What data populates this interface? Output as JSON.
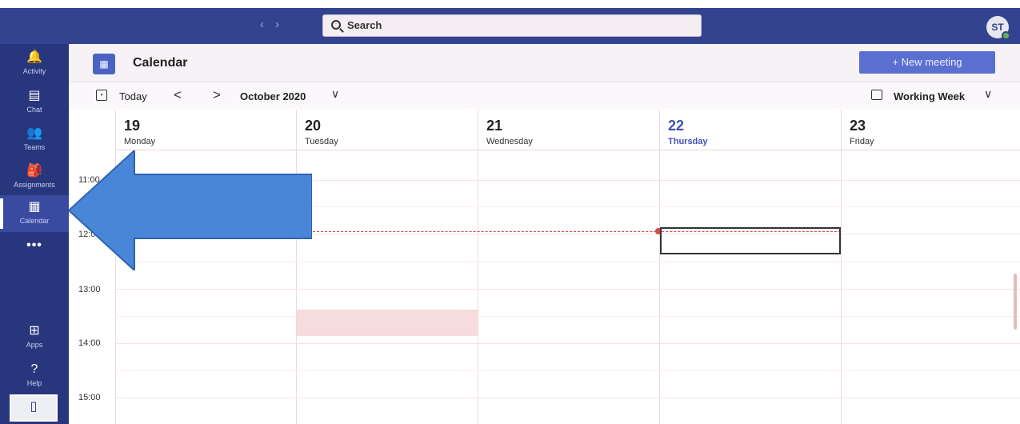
{
  "topbar": {
    "back_glyph": "‹",
    "forward_glyph": "›",
    "search_placeholder": "Search",
    "avatar_initials": "ST"
  },
  "rail": {
    "items": [
      {
        "label": "Activity",
        "icon": "bell-icon",
        "glyph": "🔔"
      },
      {
        "label": "Chat",
        "icon": "chat-icon",
        "glyph": "▤"
      },
      {
        "label": "Teams",
        "icon": "teams-icon",
        "glyph": "👥"
      },
      {
        "label": "Assignments",
        "icon": "assignments-icon",
        "glyph": "🎒"
      },
      {
        "label": "Calendar",
        "icon": "calendar-icon",
        "glyph": "▦"
      },
      {
        "label": "Apps",
        "icon": "apps-icon",
        "glyph": "⊞"
      },
      {
        "label": "Help",
        "icon": "help-icon",
        "glyph": "?"
      }
    ],
    "more_glyph": "•••",
    "device_glyph": "▯"
  },
  "calendar": {
    "title": "Calendar",
    "new_meeting_label": "+ New meeting",
    "today_label": "Today",
    "prev_glyph": "<",
    "next_glyph": ">",
    "month_label": "October 2020",
    "view_label": "Working Week",
    "chevron_glyph": "∨",
    "days": [
      {
        "num": "19",
        "name": "Monday"
      },
      {
        "num": "20",
        "name": "Tuesday"
      },
      {
        "num": "21",
        "name": "Wednesday"
      },
      {
        "num": "22",
        "name": "Thursday",
        "today": true
      },
      {
        "num": "23",
        "name": "Friday"
      }
    ],
    "times": [
      "11:00",
      "12:00",
      "13:00",
      "14:00",
      "15:00"
    ]
  },
  "colors": {
    "topbar": "#33438f",
    "rail": "#28367d",
    "accent": "#5b6fd0",
    "now_line": "#d8474f",
    "annotation_arrow": "#4a86d8"
  }
}
